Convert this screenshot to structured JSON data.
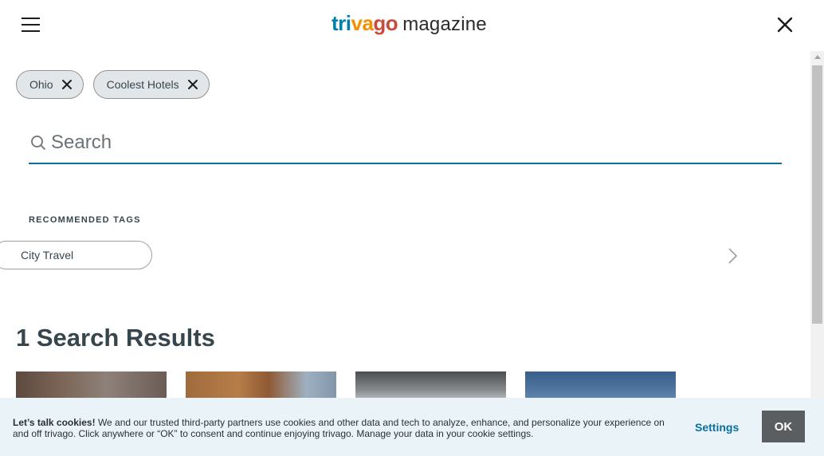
{
  "header": {
    "logo_part1": "tri",
    "logo_part2": "va",
    "logo_part3": "go",
    "logo_suffix": "magazine",
    "menu_icon": "hamburger-menu-icon",
    "close_icon": "close-icon"
  },
  "filters": {
    "chips": [
      {
        "label": "Ohio"
      },
      {
        "label": "Coolest Hotels"
      }
    ]
  },
  "search": {
    "placeholder": "Search",
    "value": ""
  },
  "recommended": {
    "title": "RECOMMENDED TAGS",
    "tags": [
      {
        "label": "City Travel"
      }
    ],
    "next_icon": "chevron-right-icon"
  },
  "results": {
    "title": "1 Search Results"
  },
  "cookie_banner": {
    "heading": "Let’s talk cookies!",
    "body": "We and our trusted third-party partners use cookies and other data and tech to analyze, enhance, and personalize your experience on and off trivago. Click anywhere or “OK” to consent and continue enjoying trivago. Manage your data in your cookie settings.",
    "settings_label": "Settings",
    "ok_label": "OK"
  },
  "colors": {
    "brand_blue": "#007fad",
    "brand_orange": "#f48f00",
    "brand_red": "#c94a38",
    "accent_link": "#0a6f9f",
    "banner_bg": "#eaf4f8"
  }
}
